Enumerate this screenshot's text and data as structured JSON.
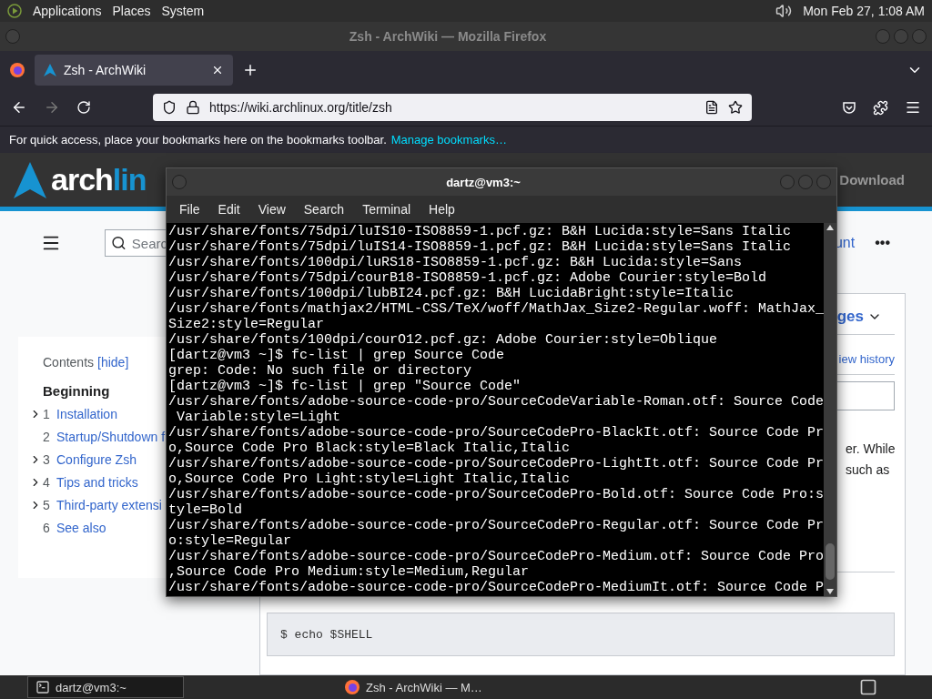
{
  "top_panel": {
    "menus": [
      "Applications",
      "Places",
      "System"
    ],
    "clock": "Mon Feb 27, 1:08 AM"
  },
  "browser": {
    "title": "Zsh - ArchWiki — Mozilla Firefox",
    "tabs": [
      {
        "label": "Zsh - ArchWiki",
        "selected": true
      }
    ],
    "url": "https://wiki.archlinux.org/title/zsh",
    "bookmarks_hint": "For quick access, place your bookmarks here on the bookmarks toolbar.",
    "bookmarks_link": "Manage bookmarks…"
  },
  "wiki": {
    "logo": {
      "part_1": "arch",
      "part_2": "lin"
    },
    "nav_link": "Download",
    "search_placeholder": "Searc",
    "account_link": "unt",
    "more": "•••",
    "toc": {
      "title": "Contents",
      "toggle": "[hide]",
      "heading": "Beginning",
      "items": [
        {
          "number": "1",
          "label": "Installation",
          "expandable": true
        },
        {
          "number": "2",
          "label": "Startup/Shutdown f",
          "expandable": false
        },
        {
          "number": "3",
          "label": "Configure Zsh",
          "expandable": true
        },
        {
          "number": "4",
          "label": "Tips and tricks",
          "expandable": true
        },
        {
          "number": "5",
          "label": "Third-party extensi",
          "expandable": true
        },
        {
          "number": "6",
          "label": "See also",
          "expandable": false
        }
      ]
    },
    "languages": "ges",
    "view_history": "iew history",
    "text_lines": [
      "er. While",
      "such as"
    ],
    "code": "$ echo $SHELL"
  },
  "terminal": {
    "title": "dartz@vm3:~",
    "menus": [
      "File",
      "Edit",
      "View",
      "Search",
      "Terminal",
      "Help"
    ],
    "lines": [
      "/usr/share/fonts/75dpi/luIS10-ISO8859-1.pcf.gz: B&H Lucida:style=Sans Italic",
      "/usr/share/fonts/75dpi/luIS14-ISO8859-1.pcf.gz: B&H Lucida:style=Sans Italic",
      "/usr/share/fonts/100dpi/luRS18-ISO8859-1.pcf.gz: B&H Lucida:style=Sans",
      "/usr/share/fonts/75dpi/courB18-ISO8859-1.pcf.gz: Adobe Courier:style=Bold",
      "/usr/share/fonts/100dpi/lubBI24.pcf.gz: B&H LucidaBright:style=Italic",
      "/usr/share/fonts/mathjax2/HTML-CSS/TeX/woff/MathJax_Size2-Regular.woff: MathJax_",
      "Size2:style=Regular",
      "/usr/share/fonts/100dpi/courO12.pcf.gz: Adobe Courier:style=Oblique",
      "[dartz@vm3 ~]$ fc-list | grep Source Code",
      "grep: Code: No such file or directory",
      "[dartz@vm3 ~]$ fc-list | grep \"Source Code\"",
      "/usr/share/fonts/adobe-source-code-pro/SourceCodeVariable-Roman.otf: Source Code",
      " Variable:style=Light",
      "/usr/share/fonts/adobe-source-code-pro/SourceCodePro-BlackIt.otf: Source Code Pr",
      "o,Source Code Pro Black:style=Black Italic,Italic",
      "/usr/share/fonts/adobe-source-code-pro/SourceCodePro-LightIt.otf: Source Code Pr",
      "o,Source Code Pro Light:style=Light Italic,Italic",
      "/usr/share/fonts/adobe-source-code-pro/SourceCodePro-Bold.otf: Source Code Pro:s",
      "tyle=Bold",
      "/usr/share/fonts/adobe-source-code-pro/SourceCodePro-Regular.otf: Source Code Pr",
      "o:style=Regular",
      "/usr/share/fonts/adobe-source-code-pro/SourceCodePro-Medium.otf: Source Code Pro",
      ",Source Code Pro Medium:style=Medium,Regular",
      "/usr/share/fonts/adobe-source-code-pro/SourceCodePro-MediumIt.otf: Source Code P"
    ]
  },
  "taskbar": {
    "tasks": [
      {
        "label": "dartz@vm3:~",
        "kind": "terminal",
        "selected": true
      },
      {
        "label": "Zsh - ArchWiki — M…",
        "kind": "browser",
        "selected": false
      }
    ]
  }
}
